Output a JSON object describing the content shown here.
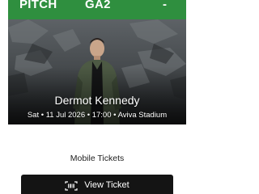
{
  "ticket": {
    "area": "PITCH",
    "section": "GA2",
    "seat": "-",
    "header_color": "#2f8f3f"
  },
  "event": {
    "artist": "Dermot Kennedy",
    "details": "Sat • 11 Jul 2026 • 17:00 • Aviva Stadium"
  },
  "ticket_type": "Mobile Tickets",
  "actions": {
    "view_ticket_label": "View Ticket",
    "view_ticket_icon": "barcode-scan-icon"
  }
}
